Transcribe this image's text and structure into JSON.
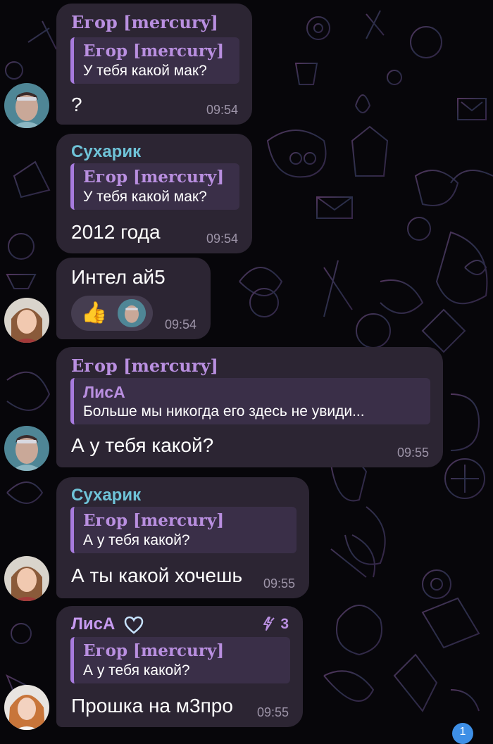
{
  "colors": {
    "background": "#07060a",
    "bubble": "#2c2533",
    "quote_bg": "#3a2f48",
    "accent_purple": "#b98fe0",
    "accent_cyan": "#6fc3d8",
    "timestamp": "#9d94a8",
    "badge": "#3e8fe6"
  },
  "messages": [
    {
      "sender": "Егор [mercury]",
      "reply": {
        "name": "Егор [mercury]",
        "text": "У тебя какой мак?"
      },
      "text": "?",
      "time": "09:54"
    },
    {
      "sender": "Сухарик",
      "reply": {
        "name": "Егор [mercury]",
        "text": "У тебя какой мак?"
      },
      "text": "2012 года",
      "time": "09:54"
    },
    {
      "text": "Интел ай5",
      "reaction_emoji": "👍",
      "time": "09:54"
    },
    {
      "sender": "Егор [mercury]",
      "reply": {
        "name": "ЛисА",
        "text": "Больше мы никогда его здесь не увиди..."
      },
      "text": "А у тебя какой?",
      "time": "09:55"
    },
    {
      "sender": "Сухарик",
      "reply": {
        "name": "Егор [mercury]",
        "text": "А у тебя какой?"
      },
      "text": "А ты какой хочешь",
      "time": "09:55"
    },
    {
      "sender": "ЛисА",
      "sender_icon": "heart-icon",
      "boost_icon": "boost-lightning-icon",
      "boost_count": "3",
      "reply": {
        "name": "Егор [mercury]",
        "text": "А у тебя какой?"
      },
      "text": "Прошка на м3про",
      "time": "09:55"
    }
  ],
  "unread_badge": "1"
}
